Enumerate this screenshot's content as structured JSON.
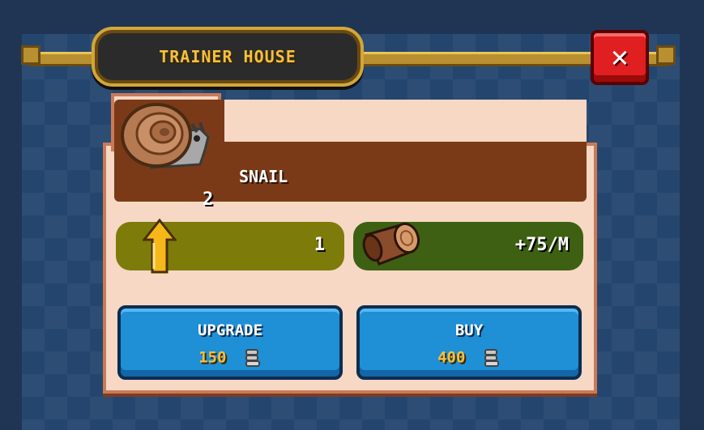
{
  "header": {
    "title": "TRAINER HOUSE",
    "close_label": "✕"
  },
  "pet": {
    "name": "SNAIL",
    "count": "2",
    "icon": "snail-icon"
  },
  "stats": {
    "level": {
      "icon": "upgrade-arrow-icon",
      "value": "1"
    },
    "production": {
      "icon": "wood-log-icon",
      "value": "+75/M"
    }
  },
  "actions": {
    "upgrade": {
      "label": "UPGRADE",
      "price": "150",
      "currency_icon": "coin-stack-icon"
    },
    "buy": {
      "label": "BUY",
      "price": "400",
      "currency_icon": "coin-stack-icon"
    }
  },
  "colors": {
    "title_text": "#f3c040",
    "close_button": "#e02020",
    "button_blue": "#1f8fd6",
    "name_bar": "#7a3a17",
    "level_bar": "#7d7b0a",
    "production_bar": "#3d6012"
  }
}
